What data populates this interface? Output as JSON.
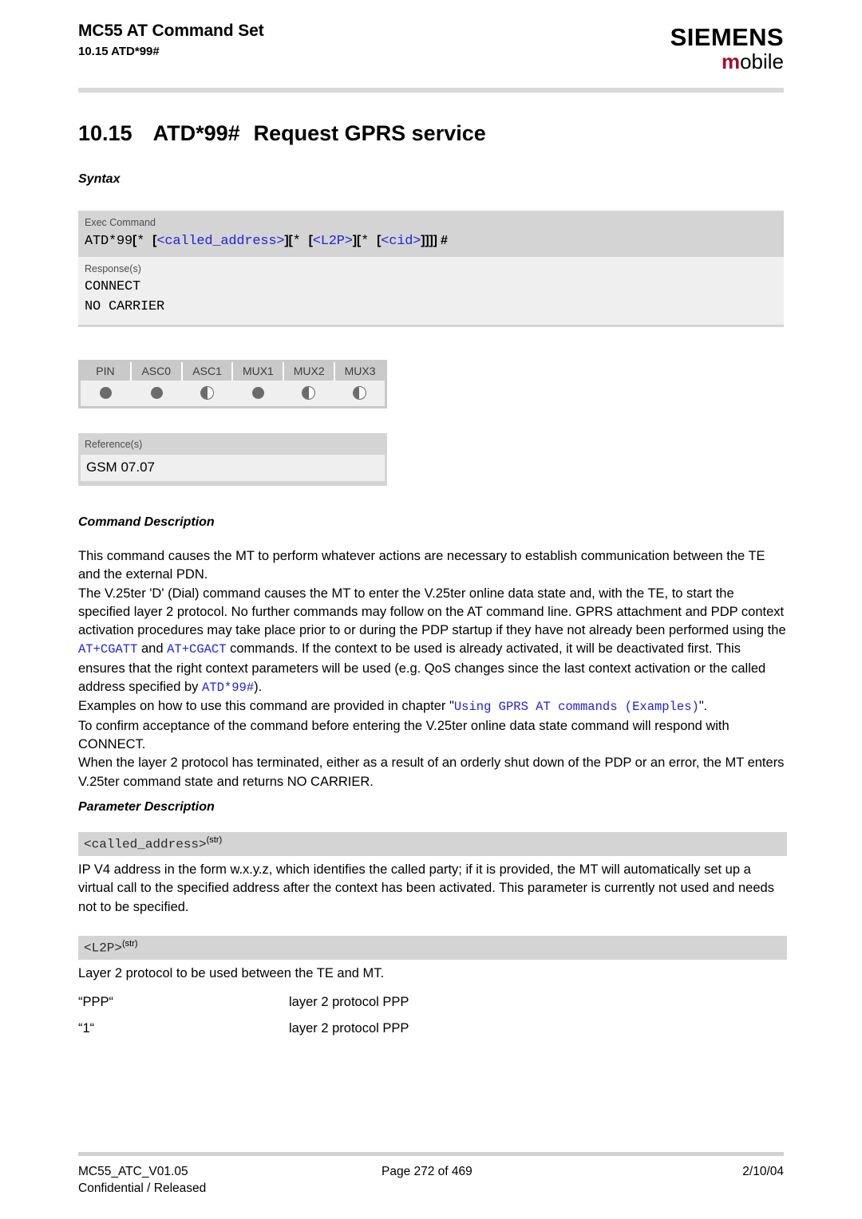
{
  "header": {
    "doc_title": "MC55 AT Command Set",
    "doc_subtitle": "10.15 ATD*99#",
    "brand_main": "SIEMENS",
    "brand_sub_accent": "m",
    "brand_sub_rest": "obile",
    "accent_color": "#a50d2e"
  },
  "section": {
    "number": "10.15",
    "command": "ATD*99#",
    "title": "Request GPRS service"
  },
  "headings": {
    "syntax": "Syntax",
    "command_description": "Command Description",
    "parameter_description": "Parameter Description"
  },
  "syntax": {
    "exec_label": "Exec Command",
    "exec_parts": [
      {
        "text": "ATD*99",
        "style": "mono"
      },
      {
        "text": "[",
        "style": "plain-bold"
      },
      {
        "text": "* ",
        "style": "mono"
      },
      {
        "text": "[",
        "style": "plain-bold"
      },
      {
        "text": "<called_address>",
        "style": "placeholder"
      },
      {
        "text": "]",
        "style": "plain-bold"
      },
      {
        "text": "[",
        "style": "plain-bold"
      },
      {
        "text": "* ",
        "style": "mono"
      },
      {
        "text": "[",
        "style": "plain-bold"
      },
      {
        "text": "<L2P>",
        "style": "placeholder"
      },
      {
        "text": "]",
        "style": "plain-bold"
      },
      {
        "text": "[",
        "style": "plain-bold"
      },
      {
        "text": "* ",
        "style": "mono"
      },
      {
        "text": "[",
        "style": "plain-bold"
      },
      {
        "text": "<cid>",
        "style": "placeholder"
      },
      {
        "text": "]]]]",
        "style": "plain-bold"
      },
      {
        "text": " #",
        "style": "plain-bold"
      }
    ],
    "exec_plain": "ATD*99[* [<called_address>][* [<L2P>][* [<cid>]]]] #",
    "response_label": "Response(s)",
    "responses": [
      "CONNECT",
      "NO CARRIER"
    ]
  },
  "pin_table": {
    "columns": [
      "PIN",
      "ASC0",
      "ASC1",
      "MUX1",
      "MUX2",
      "MUX3"
    ],
    "states": [
      "full",
      "full",
      "half",
      "full",
      "half",
      "half"
    ]
  },
  "reference": {
    "label": "Reference(s)",
    "value": "GSM 07.07"
  },
  "command_description": {
    "paragraphs": [
      "This command causes the MT to perform whatever actions are necessary to establish communication between the TE and the external PDN.",
      "The V.25ter 'D' (Dial) command causes the MT to enter the V.25ter online data state and, with the TE, to start the specified layer 2 protocol. No further commands may follow on the AT command line. GPRS attachment and PDP context activation procedures may take place prior to or during the PDP startup if they have not already been performed using the AT+CGATT and AT+CGACT commands. If the context to be used is already activated, it will be deactivated first. This ensures that the right context parameters will be used (e.g. QoS changes since the last context activation or the called address specified by ATD*99#).",
      "Examples on how to use this command are provided in chapter \"Using GPRS AT commands (Examples)\".",
      "To confirm acceptance of the command before entering the V.25ter online data state command will respond with CONNECT.",
      "When the layer 2 protocol has terminated, either as a result of an orderly shut down of the PDP or an error, the MT enters V.25ter command state and returns NO CARRIER."
    ],
    "inline_code": [
      "AT+CGATT",
      "AT+CGACT",
      "ATD*99#",
      "Using GPRS AT commands (Examples)"
    ]
  },
  "parameters": [
    {
      "name": "<called_address>",
      "type_sup": "(str)",
      "description": "IP V4 address in the form w.x.y.z, which identifies the called party; if it is provided, the MT will automatically set up a virtual call to the specified address after the context has been activated. This parameter is currently not used and needs not to be specified."
    },
    {
      "name": "<L2P>",
      "type_sup": "(str)",
      "description": "Layer 2 protocol to be used between the TE and MT.",
      "values": [
        {
          "key": "“PPP“",
          "desc": "layer 2 protocol PPP"
        },
        {
          "key": "“1“",
          "desc": "layer 2 protocol PPP"
        }
      ]
    }
  ],
  "footer": {
    "doc_id": "MC55_ATC_V01.05",
    "page": "Page 272 of 469",
    "date": "2/10/04",
    "classification": "Confidential / Released"
  }
}
